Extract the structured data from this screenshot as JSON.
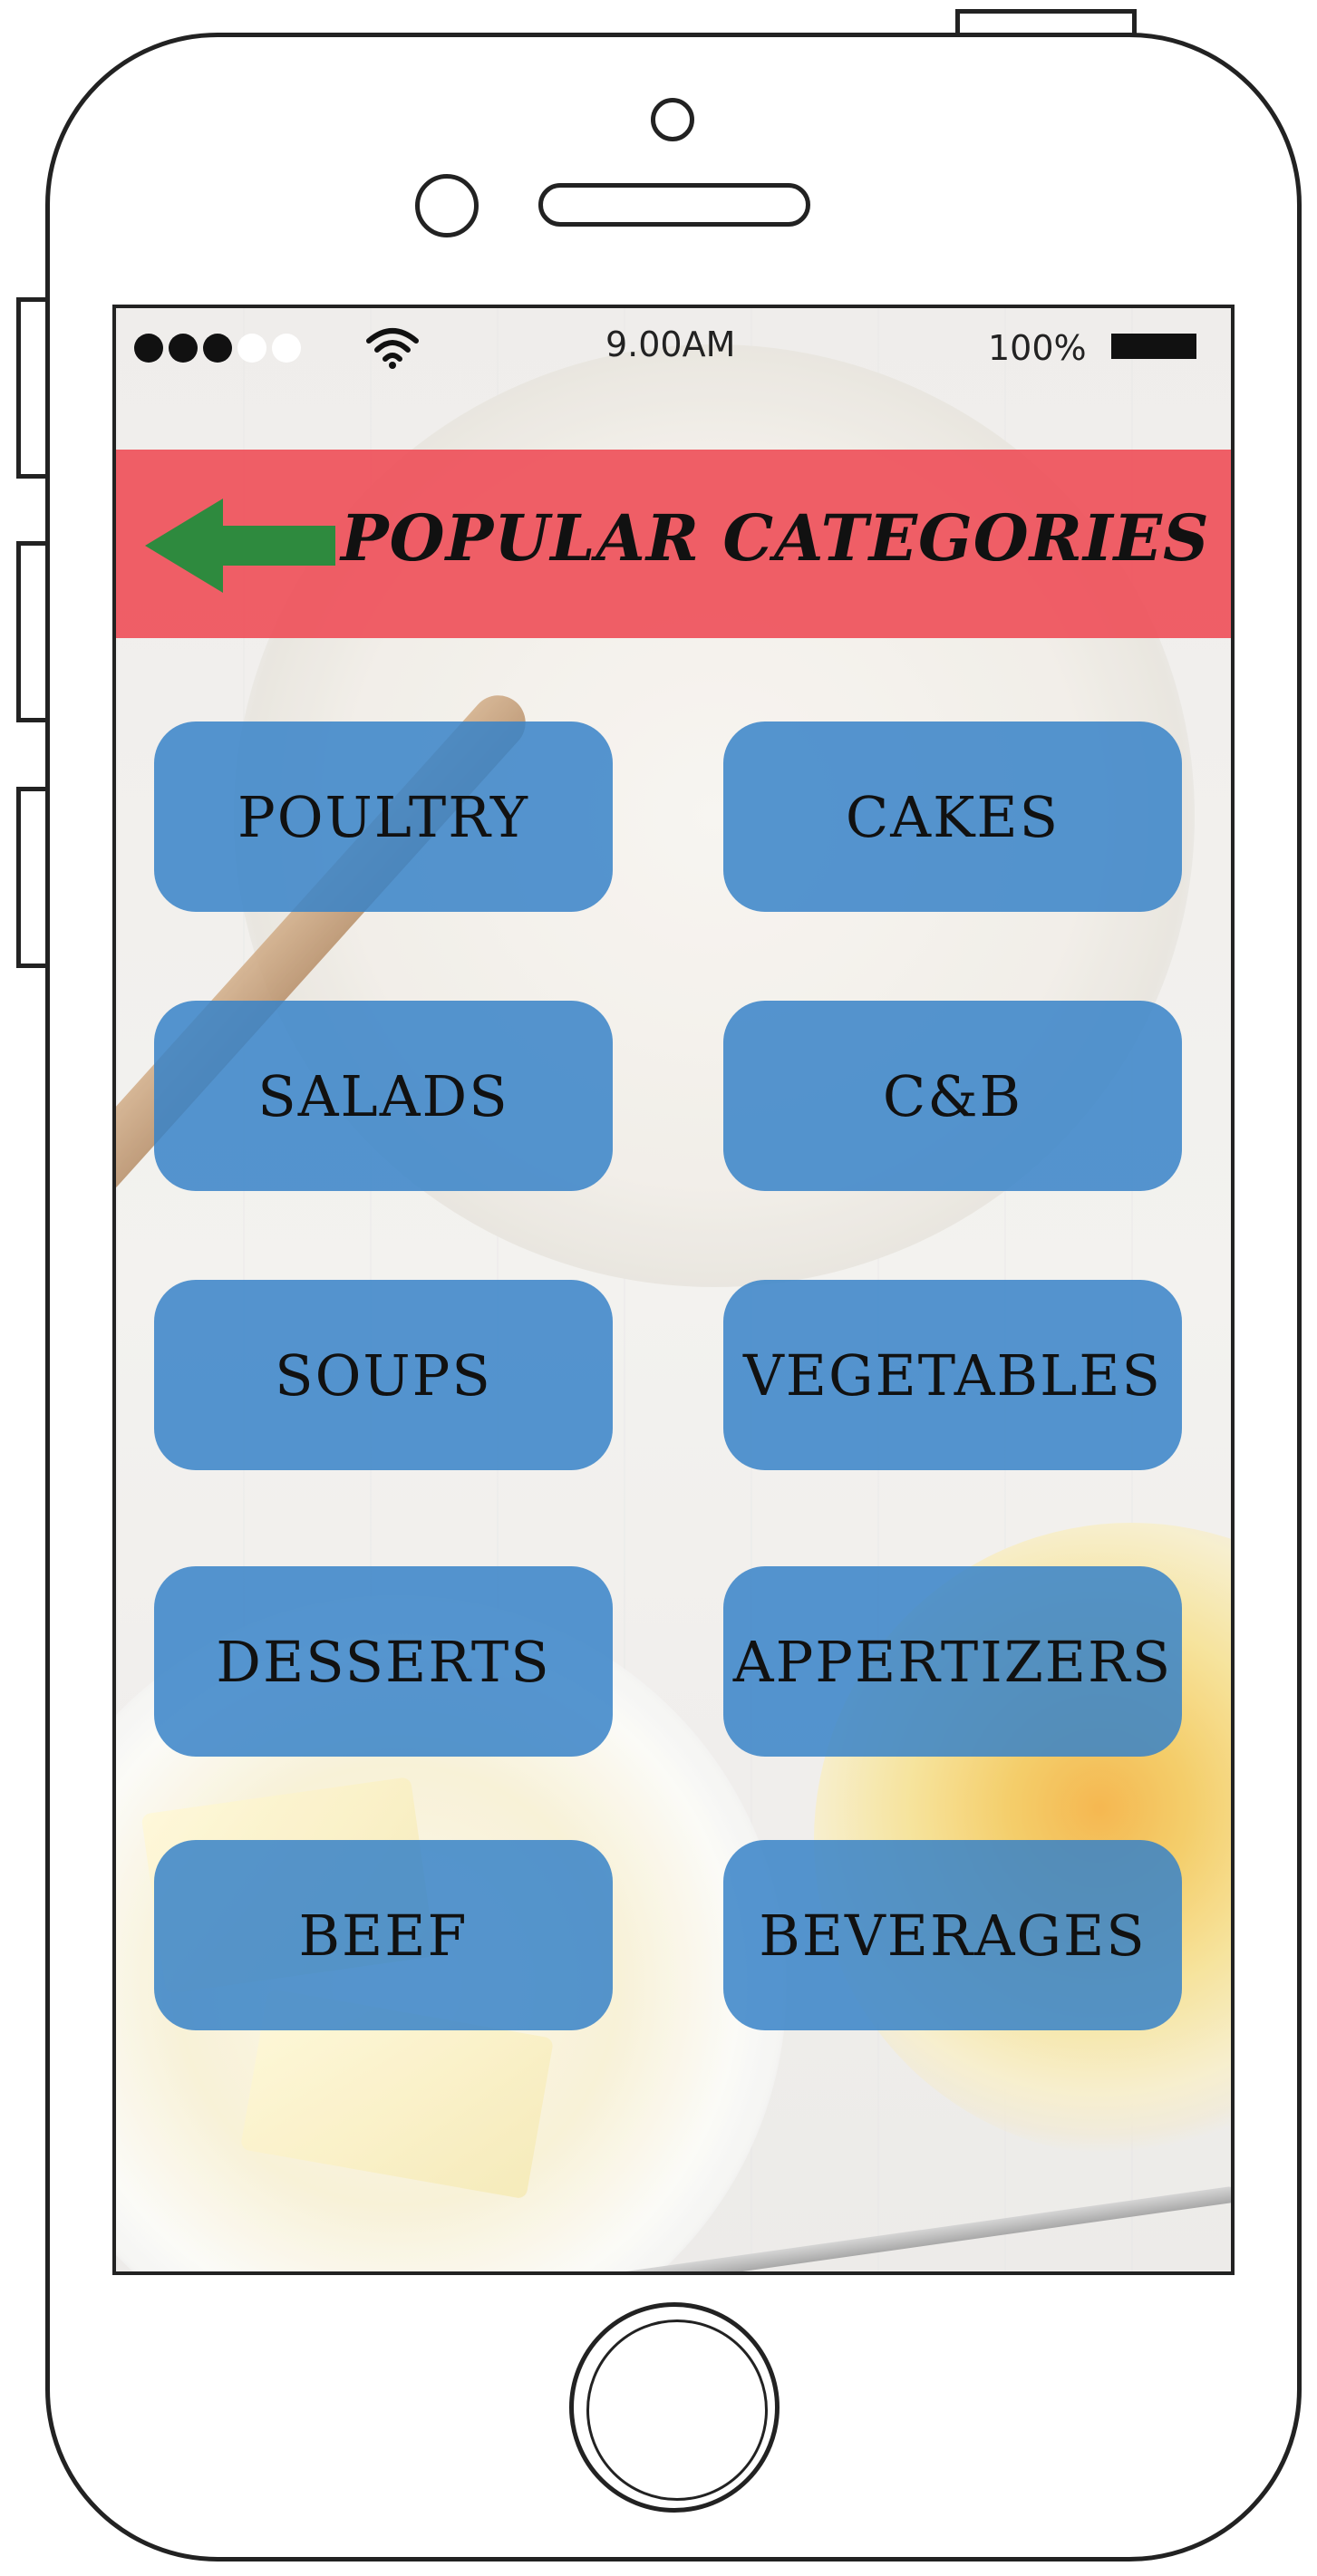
{
  "status_bar": {
    "time": "9.00AM",
    "battery": "100%",
    "signal_dots": [
      "filled",
      "filled",
      "filled",
      "empty",
      "empty"
    ]
  },
  "header": {
    "title": "POPULAR CATEGORIES",
    "back_icon": "arrow-left-icon",
    "background_color": "#ee4e58",
    "back_icon_color": "#2e8a3e"
  },
  "categories": [
    {
      "label": "POULTRY"
    },
    {
      "label": "CAKES"
    },
    {
      "label": "SALADS"
    },
    {
      "label": "C&B"
    },
    {
      "label": "SOUPS"
    },
    {
      "label": "VEGETABLES"
    },
    {
      "label": "DESSERTS"
    },
    {
      "label": "APPERTIZERS"
    },
    {
      "label": "BEEF"
    },
    {
      "label": "BEVERAGES"
    }
  ],
  "category_button_color": "#3782c8"
}
